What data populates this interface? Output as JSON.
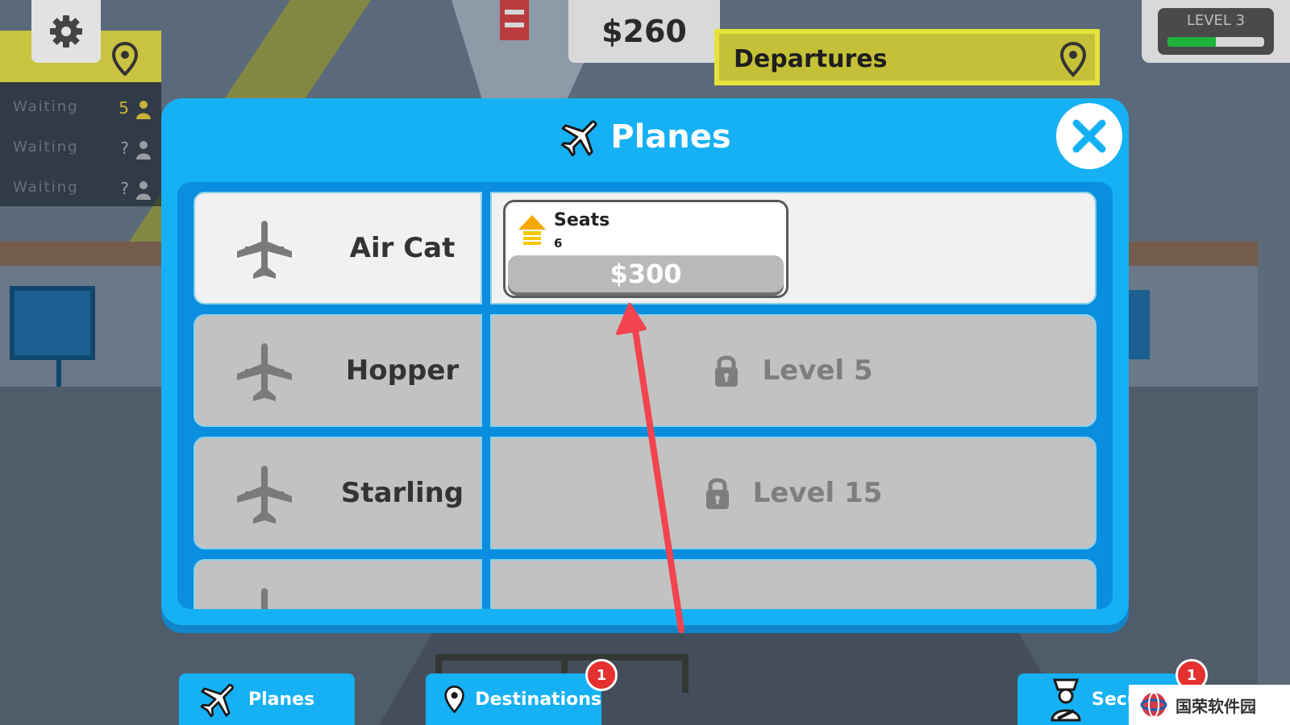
{
  "hud": {
    "money": "$260",
    "level_label": "LEVEL 3",
    "level_progress": 0.5,
    "departures_label": "Departures"
  },
  "waiting_board": {
    "rows": [
      {
        "label": "Waiting",
        "count": "5"
      },
      {
        "label": "Waiting",
        "count": "?"
      },
      {
        "label": "Waiting",
        "count": "?"
      }
    ]
  },
  "modal": {
    "title": "Planes",
    "title_icon": "airplane-icon",
    "close_icon": "close-icon"
  },
  "planes": [
    {
      "name": "Air Cat",
      "upgrade_label": "Seats",
      "upgrade_value": "6",
      "price": "$300"
    },
    {
      "name": "Hopper",
      "locked_label": "Level 5"
    },
    {
      "name": "Starling",
      "locked_label": "Level 15"
    }
  ],
  "bottom_tabs": [
    {
      "label": "Planes",
      "icon": "airplane-icon"
    },
    {
      "label": "Destinations",
      "icon": "map-pin-icon",
      "badge": "1"
    },
    {
      "label": "Secu",
      "icon": "security-officer-icon",
      "badge": "1"
    }
  ],
  "watermark": {
    "text": "国荣软件园"
  },
  "colors": {
    "modal_blue": "#16b1f4",
    "panel_blue": "#0a8edf",
    "badge_red": "#e53030",
    "level_green": "#1db33b",
    "departures_yellow": "#c4c138",
    "annotation_arrow": "#f2434f"
  }
}
